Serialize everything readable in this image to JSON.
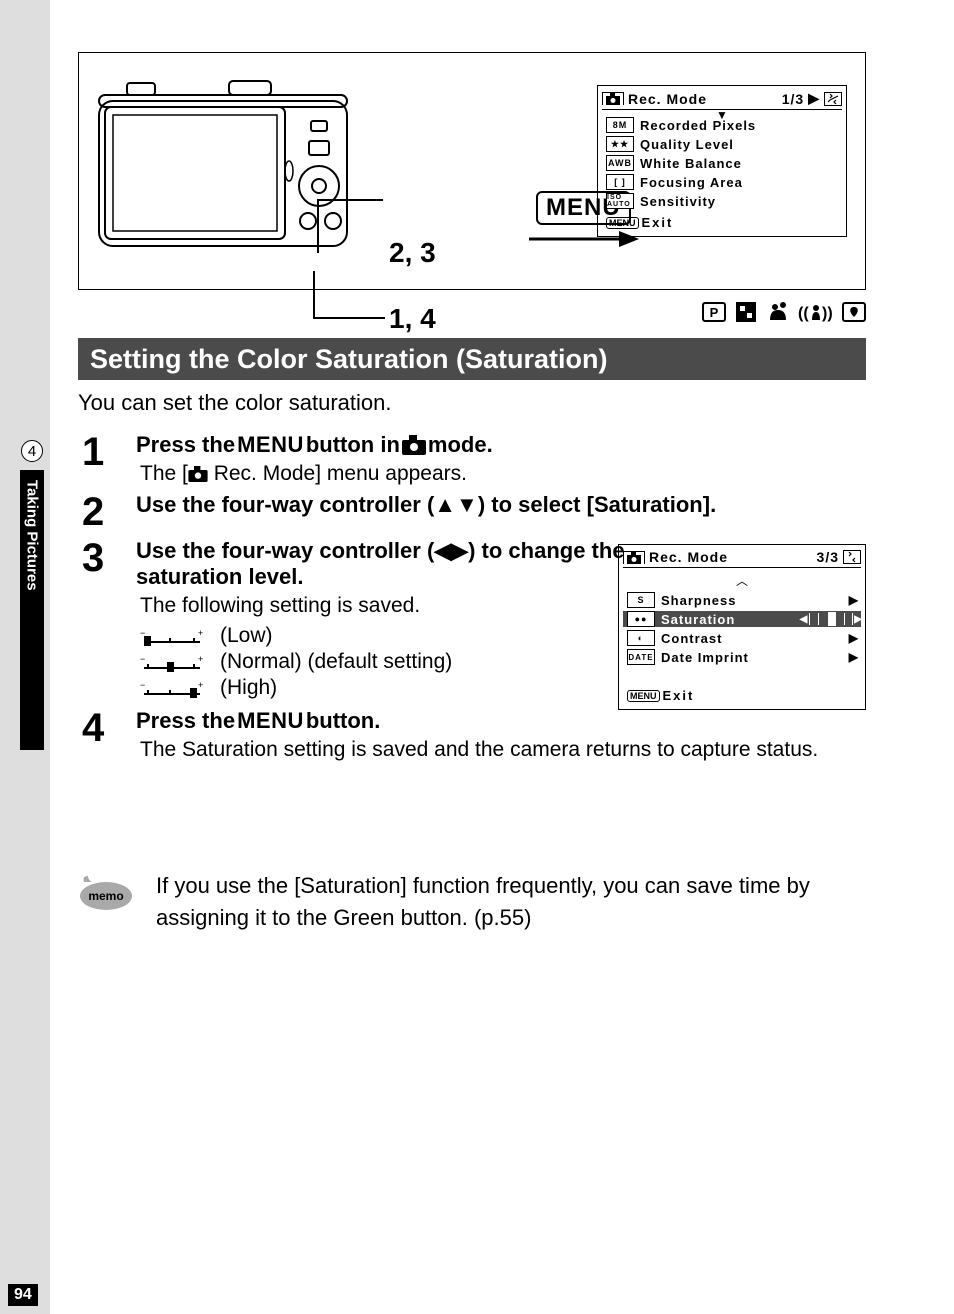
{
  "figure": {
    "callout_buttons_label": "2, 3",
    "callout_buttons_label2": "1, 4",
    "menu_button_label": "MENU"
  },
  "screen1": {
    "title": "Rec. Mode",
    "page": "1/3",
    "items": [
      {
        "icon": "8M",
        "label": "Recorded Pixels"
      },
      {
        "icon": "★★",
        "label": "Quality Level"
      },
      {
        "icon": "AWB",
        "label": "White Balance"
      },
      {
        "icon": "[ ]",
        "label": "Focusing Area"
      },
      {
        "icon": "ISO AUTO",
        "label": "Sensitivity"
      }
    ],
    "exit": "Exit",
    "menu_badge": "MENU"
  },
  "section_title": "Setting the Color Saturation (Saturation)",
  "intro": "You can set the color saturation.",
  "side": {
    "chapter": "4",
    "label": "Taking Pictures"
  },
  "steps": {
    "s1": {
      "num": "1",
      "head_a": "Press the ",
      "head_menu": "MENU",
      "head_b": " button in ",
      "head_c": " mode.",
      "sub_a": "The [",
      "sub_b": " Rec. Mode] menu appears."
    },
    "s2": {
      "num": "2",
      "head": "Use the four-way controller (▲▼) to select [Saturation]."
    },
    "s3": {
      "num": "3",
      "head": "Use the four-way controller (◀▶) to change the saturation level.",
      "sub": "The following setting is saved.",
      "opts": {
        "low": "(Low)",
        "normal": "(Normal) (default setting)",
        "high": "(High)"
      }
    },
    "s4": {
      "num": "4",
      "head_a": "Press the ",
      "head_menu": "MENU",
      "head_b": " button.",
      "sub": "The Saturation setting is saved and the camera returns to capture status."
    }
  },
  "screen2": {
    "title": "Rec. Mode",
    "page": "3/3",
    "items": [
      {
        "icon": "S",
        "label": "Sharpness"
      },
      {
        "icon": "●●",
        "label": "Saturation",
        "selected": true
      },
      {
        "icon": "◐",
        "label": "Contrast"
      },
      {
        "icon": "DATE",
        "label": "Date Imprint"
      }
    ],
    "exit": "Exit",
    "menu_badge": "MENU"
  },
  "memo": {
    "text": "If you use the [Saturation] function frequently, you can save time by assigning it to the Green button. (p.55)"
  },
  "page_number": "94"
}
